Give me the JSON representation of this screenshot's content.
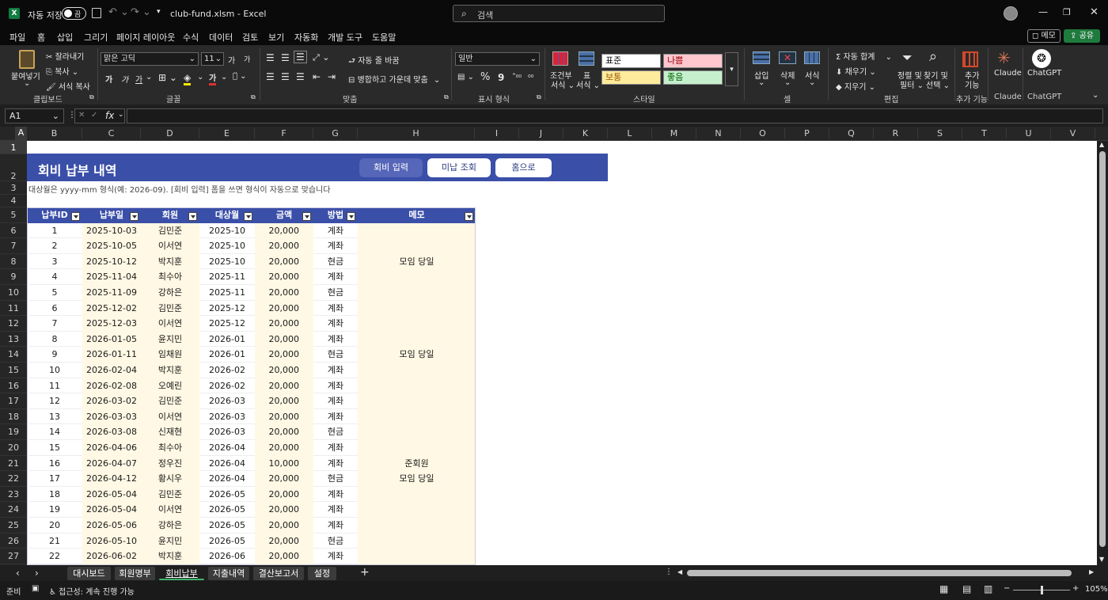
{
  "titlebar": {
    "autosave_label": "자동 저장",
    "autosave_state": "끔",
    "filename": "club-fund.xlsm",
    "separator": "-",
    "app": "Excel",
    "search_placeholder": "검색"
  },
  "menu": [
    "파일",
    "홈",
    "삽입",
    "그리기",
    "페이지 레이아웃",
    "수식",
    "데이터",
    "검토",
    "보기",
    "자동화",
    "개발 도구",
    "도움말"
  ],
  "menu_active": "홈",
  "menu_right": {
    "memo": "메모",
    "share": "공유"
  },
  "ribbon": {
    "clipboard": {
      "paste": "붙여넣기",
      "cut": "잘라내기",
      "copy": "복사",
      "format_painter": "서식 복사",
      "label": "클립보드"
    },
    "font": {
      "name": "맑은 고딕",
      "size": "11",
      "grow": "가",
      "shrink": "가",
      "bold": "가",
      "italic": "가",
      "underline": "가",
      "color_glyph": "가",
      "label": "글꼴"
    },
    "align": {
      "wrap": "자동 줄 바꿈",
      "merge": "병합하고 가운데 맞춤",
      "label": "맞춤"
    },
    "number": {
      "format": "일반",
      "percent": "%",
      "comma": "9",
      "label": "표시 형식"
    },
    "styles": {
      "cond": "조건부",
      "cond2": "서식",
      "table": "표",
      "table2": "서식",
      "normal": "표준",
      "bad": "나쁨",
      "neutral": "보통",
      "good": "좋음",
      "label": "스타일"
    },
    "cells": {
      "insert": "삽입",
      "delete": "삭제",
      "format": "서식",
      "label": "셀"
    },
    "editing": {
      "autosum": "자동 합계",
      "fill": "채우기",
      "clear": "지우기",
      "sort": "정렬 및",
      "sort2": "필터",
      "find": "찾기 및",
      "find2": "선택",
      "label": "편집"
    },
    "addins": {
      "label1": "추가",
      "label2": "기능",
      "label": "추가 기능"
    },
    "claude": {
      "label": "Claude",
      "group": "Claude"
    },
    "chatgpt": {
      "label": "ChatGPT",
      "group": "ChatGPT"
    }
  },
  "formula_bar": {
    "namebox": "A1",
    "fx": "fx",
    "value": ""
  },
  "columns": [
    "A",
    "B",
    "C",
    "D",
    "E",
    "F",
    "G",
    "H",
    "I",
    "J",
    "K",
    "L",
    "M",
    "N",
    "O",
    "P",
    "Q",
    "R",
    "S",
    "T",
    "U",
    "V"
  ],
  "rows": [
    "1",
    "2",
    "3",
    "4",
    "5",
    "6",
    "7",
    "8",
    "9",
    "10",
    "11",
    "12",
    "13",
    "14",
    "15",
    "16",
    "17",
    "18",
    "19",
    "20",
    "21",
    "22",
    "23",
    "24",
    "25",
    "26",
    "27"
  ],
  "sheet": {
    "title": "회비 납부 내역",
    "buttons": [
      "회비 입력",
      "미납 조회",
      "홈으로"
    ],
    "note": "대상월은 yyyy-mm 형식(예: 2026-09). [회비 입력] 폼을 쓰면 형식이 자동으로 맞습니다",
    "headers": [
      "납부ID",
      "납부일",
      "회원",
      "대상월",
      "금액",
      "방법",
      "메모"
    ],
    "rows": [
      [
        "1",
        "2025-10-03",
        "김민준",
        "2025-10",
        "20,000",
        "계좌",
        ""
      ],
      [
        "2",
        "2025-10-05",
        "이서연",
        "2025-10",
        "20,000",
        "계좌",
        ""
      ],
      [
        "3",
        "2025-10-12",
        "박지훈",
        "2025-10",
        "20,000",
        "현금",
        "모임 당일"
      ],
      [
        "4",
        "2025-11-04",
        "최수아",
        "2025-11",
        "20,000",
        "계좌",
        ""
      ],
      [
        "5",
        "2025-11-09",
        "강하은",
        "2025-11",
        "20,000",
        "현금",
        ""
      ],
      [
        "6",
        "2025-12-02",
        "김민준",
        "2025-12",
        "20,000",
        "계좌",
        ""
      ],
      [
        "7",
        "2025-12-03",
        "이서연",
        "2025-12",
        "20,000",
        "계좌",
        ""
      ],
      [
        "8",
        "2026-01-05",
        "윤지민",
        "2026-01",
        "20,000",
        "계좌",
        ""
      ],
      [
        "9",
        "2026-01-11",
        "임채원",
        "2026-01",
        "20,000",
        "현금",
        "모임 당일"
      ],
      [
        "10",
        "2026-02-04",
        "박지훈",
        "2026-02",
        "20,000",
        "계좌",
        ""
      ],
      [
        "11",
        "2026-02-08",
        "오예린",
        "2026-02",
        "20,000",
        "계좌",
        ""
      ],
      [
        "12",
        "2026-03-02",
        "김민준",
        "2026-03",
        "20,000",
        "계좌",
        ""
      ],
      [
        "13",
        "2026-03-03",
        "이서연",
        "2026-03",
        "20,000",
        "계좌",
        ""
      ],
      [
        "14",
        "2026-03-08",
        "신재현",
        "2026-03",
        "20,000",
        "현금",
        ""
      ],
      [
        "15",
        "2026-04-06",
        "최수아",
        "2026-04",
        "20,000",
        "계좌",
        ""
      ],
      [
        "16",
        "2026-04-07",
        "정우진",
        "2026-04",
        "10,000",
        "계좌",
        "준회원"
      ],
      [
        "17",
        "2026-04-12",
        "황시우",
        "2026-04",
        "20,000",
        "현금",
        "모임 당일"
      ],
      [
        "18",
        "2026-05-04",
        "김민준",
        "2026-05",
        "20,000",
        "계좌",
        ""
      ],
      [
        "19",
        "2026-05-04",
        "이서연",
        "2026-05",
        "20,000",
        "계좌",
        ""
      ],
      [
        "20",
        "2026-05-06",
        "강하은",
        "2026-05",
        "20,000",
        "계좌",
        ""
      ],
      [
        "21",
        "2026-05-10",
        "윤지민",
        "2026-05",
        "20,000",
        "현금",
        ""
      ],
      [
        "22",
        "2026-06-02",
        "박지훈",
        "2026-06",
        "20,000",
        "계좌",
        ""
      ]
    ]
  },
  "tabs": [
    "대시보드",
    "회원명부",
    "회비납부",
    "지출내역",
    "결산보고서",
    "설정"
  ],
  "active_tab": "회비납부",
  "add_sheet": "+",
  "status": {
    "ready": "준비",
    "accessibility": "접근성: 계속 진행 가능",
    "zoom": "105%"
  },
  "colors": {
    "header_blue": "#3a4fa8",
    "accent_yellow": "#fff8e4",
    "excel_green": "#107c41"
  }
}
